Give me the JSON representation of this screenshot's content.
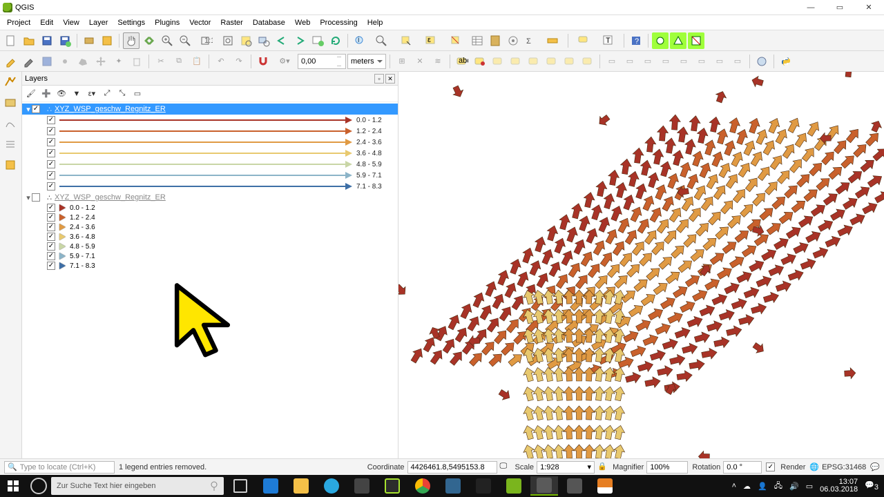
{
  "title": "QGIS",
  "menubar": [
    "Project",
    "Edit",
    "View",
    "Layer",
    "Settings",
    "Plugins",
    "Vector",
    "Raster",
    "Database",
    "Web",
    "Processing",
    "Help"
  ],
  "toolbar2": {
    "distance_value": "0,00",
    "distance_unit": "meters"
  },
  "layers_panel_title": "Layers",
  "layers": [
    {
      "name": "XYZ_WSP_geschw_Regnitz_ER",
      "visible": true,
      "selected": true,
      "classes": [
        {
          "label": "0.0 - 1.2",
          "color": "#A83327"
        },
        {
          "label": "1.2 - 2.4",
          "color": "#C9612C"
        },
        {
          "label": "2.4 - 3.6",
          "color": "#E09A43"
        },
        {
          "label": "3.6 - 4.8",
          "color": "#E8C96F"
        },
        {
          "label": "4.8 - 5.9",
          "color": "#C9D6A6"
        },
        {
          "label": "5.9 - 7.1",
          "color": "#8CB4C8"
        },
        {
          "label": "7.1 - 8.3",
          "color": "#3E6FA6"
        }
      ]
    },
    {
      "name": "XYZ_WSP_geschw_Regnitz_ER",
      "visible": false,
      "selected": false,
      "classes": [
        {
          "label": "0.0 - 1.2",
          "color": "#A83327"
        },
        {
          "label": "1.2 - 2.4",
          "color": "#C9612C"
        },
        {
          "label": "2.4 - 3.6",
          "color": "#E09A43"
        },
        {
          "label": "3.6 - 4.8",
          "color": "#E8C96F"
        },
        {
          "label": "4.8 - 5.9",
          "color": "#C9D6A6"
        },
        {
          "label": "5.9 - 7.1",
          "color": "#8CB4C8"
        },
        {
          "label": "7.1 - 8.3",
          "color": "#3E6FA6"
        }
      ]
    }
  ],
  "statusbar": {
    "locator_placeholder": "Type to locate (Ctrl+K)",
    "message": "1 legend entries removed.",
    "coord_label": "Coordinate",
    "coord_value": "4426461.8,5495153.8",
    "scale_label": "Scale",
    "scale_value": "1:928",
    "magnifier_label": "Magnifier",
    "magnifier_value": "100%",
    "rotation_label": "Rotation",
    "rotation_value": "0.0 °",
    "render_label": "Render",
    "epsg": "EPSG:31468"
  },
  "taskbar": {
    "search_placeholder": "Zur Suche Text hier eingeben",
    "time": "13:07",
    "date": "06.03.2018",
    "notif": "3"
  }
}
